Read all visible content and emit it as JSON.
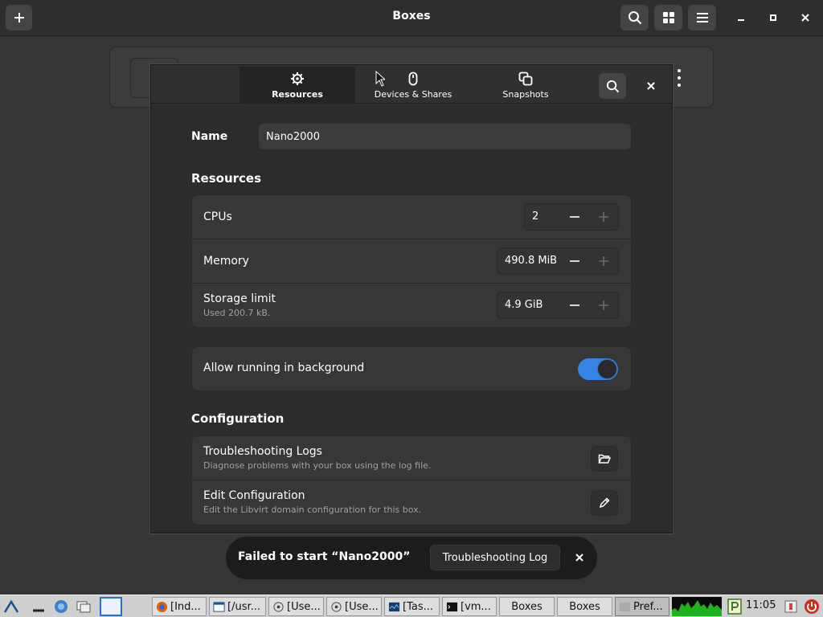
{
  "window": {
    "title": "Boxes"
  },
  "dialog": {
    "tabs": [
      {
        "label": "Resources",
        "icon": "gear-icon",
        "active": true
      },
      {
        "label": "Devices & Shares",
        "icon": "mouse-icon",
        "active": false
      },
      {
        "label": "Snapshots",
        "icon": "snapshots-icon",
        "active": false
      }
    ],
    "name_label": "Name",
    "name_value": "Nano2000",
    "resources_heading": "Resources",
    "resources": [
      {
        "title": "CPUs",
        "subtitle": "",
        "value": "2"
      },
      {
        "title": "Memory",
        "subtitle": "",
        "value": "490.8 MiB"
      },
      {
        "title": "Storage limit",
        "subtitle": "Used 200.7 kB.",
        "value": "4.9 GiB"
      }
    ],
    "background": {
      "label": "Allow running in background",
      "enabled": true
    },
    "configuration_heading": "Configuration",
    "configuration": [
      {
        "title": "Troubleshooting Logs",
        "subtitle": "Diagnose problems with your box using the log file.",
        "icon": "folder-open-icon"
      },
      {
        "title": "Edit Configuration",
        "subtitle": "Edit the Libvirt domain configuration for this box.",
        "icon": "pencil-icon"
      }
    ]
  },
  "toast": {
    "message": "Failed to start “Nano2000”",
    "button": "Troubleshooting Log"
  },
  "taskbar": {
    "tasks": [
      "[Ind...",
      "[/usr...",
      "[Use...",
      "[Use...",
      "[Tas...",
      "[vm...",
      "Boxes",
      "Boxes",
      "Pref..."
    ],
    "clock": "11:05"
  },
  "colors": {
    "accent": "#3584e4",
    "background": "#353535",
    "toast": "#1c1c1c"
  }
}
